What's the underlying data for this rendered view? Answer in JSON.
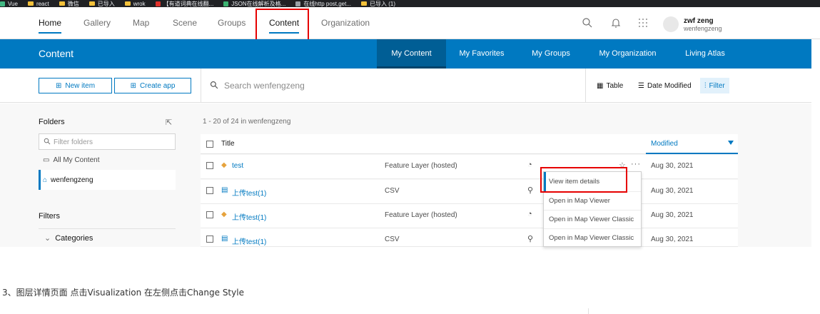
{
  "bookmarks": [
    {
      "label": "Vue",
      "kind": "logo"
    },
    {
      "label": "react",
      "kind": "folder"
    },
    {
      "label": "微信",
      "kind": "folder"
    },
    {
      "label": "已导入",
      "kind": "folder"
    },
    {
      "label": "wrok",
      "kind": "folder"
    },
    {
      "label": "【有道词典在线翻...",
      "kind": "red"
    },
    {
      "label": "JSON在线解析及格...",
      "kind": "green"
    },
    {
      "label": "在线http post,get...",
      "kind": "grey"
    },
    {
      "label": "已导入 (1)",
      "kind": "folder"
    }
  ],
  "topnav": {
    "items": [
      "Home",
      "Gallery",
      "Map",
      "Scene",
      "Groups",
      "Content",
      "Organization"
    ],
    "active": "Home",
    "highlighted": "Content",
    "user_name": "zwf zeng",
    "user_handle": "wenfengzeng"
  },
  "header": {
    "title": "Content",
    "tabs": [
      "My Content",
      "My Favorites",
      "My Groups",
      "My Organization",
      "Living Atlas"
    ],
    "active_tab": "My Content"
  },
  "toolbar": {
    "new_item": "New item",
    "create_app": "Create app",
    "search_placeholder": "Search wenfengzeng",
    "table": "Table",
    "date_modified": "Date Modified",
    "filter": "Filter"
  },
  "sidebar": {
    "folders_title": "Folders",
    "filter_placeholder": "Filter folders",
    "folders": [
      "All My Content",
      "wenfengzeng"
    ],
    "selected_folder": "wenfengzeng",
    "filters_title": "Filters",
    "categories": "Categories"
  },
  "table": {
    "count": "1 - 20 of 24 in wenfengzeng",
    "col_title": "Title",
    "col_modified": "Modified",
    "rows": [
      {
        "name": "test",
        "type": "Feature Layer (hosted)",
        "modified": "Aug 30, 2021",
        "icon": "feature-layer-icon"
      },
      {
        "name": "上传test(1)",
        "type": "CSV",
        "modified": "Aug 30, 2021",
        "icon": "csv-icon"
      },
      {
        "name": "上传test(1)",
        "type": "Feature Layer (hosted)",
        "modified": "Aug 30, 2021",
        "icon": "feature-layer-icon"
      },
      {
        "name": "上传test(1)",
        "type": "CSV",
        "modified": "Aug 30, 2021",
        "icon": "csv-icon"
      }
    ]
  },
  "menu": {
    "items": [
      "View item details",
      "Open in Map Viewer",
      "Open in Map Viewer Classic",
      "Open in Map Viewer Classic"
    ]
  },
  "caption": "3、图层详情页面 点击Visualization 在左侧点击Change Style",
  "colors": {
    "accent": "#0079c1",
    "header": "#0079c1",
    "highlight_box": "#e60000"
  }
}
